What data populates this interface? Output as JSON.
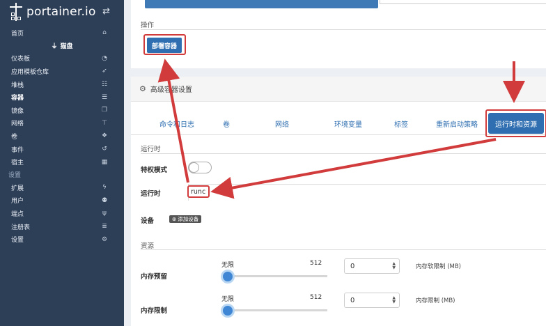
{
  "brand": {
    "logo_text": "portainer.io",
    "switch_icon": "swap-arrows-icon"
  },
  "sidebar": {
    "home_item": {
      "label": "首页",
      "icon": "home-icon"
    },
    "endpoint_name": "猫盘",
    "items": [
      {
        "label": "仪表板",
        "icon": "tachometer-icon"
      },
      {
        "label": "应用模板仓库",
        "icon": "rocket-icon"
      },
      {
        "label": "堆栈",
        "icon": "th-list-icon"
      },
      {
        "label": "容器",
        "icon": "server-icon",
        "active": true
      },
      {
        "label": "镜像",
        "icon": "clone-icon"
      },
      {
        "label": "网络",
        "icon": "sitemap-icon"
      },
      {
        "label": "卷",
        "icon": "cubes-icon"
      },
      {
        "label": "事件",
        "icon": "history-icon"
      },
      {
        "label": "宿主",
        "icon": "th-icon"
      }
    ],
    "settings_heading": "设置",
    "settings_items": [
      {
        "label": "扩展",
        "icon": "bolt-icon"
      },
      {
        "label": "用户",
        "icon": "users-icon"
      },
      {
        "label": "端点",
        "icon": "plug-icon"
      },
      {
        "label": "注册表",
        "icon": "database-icon"
      },
      {
        "label": "设置",
        "icon": "cogs-icon"
      }
    ]
  },
  "actions": {
    "title": "操作",
    "deploy_label": "部署容器"
  },
  "advanced": {
    "title": "高级容器设置",
    "tabs": [
      "命令和日志",
      "卷",
      "网络",
      "环境变量",
      "标签",
      "重新启动策略",
      "运行时和资源"
    ],
    "runtime_section": "运行时",
    "privileged_label": "特权模式",
    "runtime_label": "运行时",
    "runtime_value": "runc",
    "devices_label": "设备",
    "add_device_label": "添加设备",
    "resources_section": "资源",
    "memory_reservation": {
      "label": "内存预留",
      "min_label": "无限",
      "max_label": "512",
      "value": "0",
      "unit_label": "内存软限制 (MB)"
    },
    "memory_limit": {
      "label": "内存限制",
      "min_label": "无限",
      "max_label": "512",
      "value": "0",
      "unit_label": "内存限制 (MB)"
    }
  },
  "annotation_color": "#d23b3b",
  "accent_color": "#2f6fb1"
}
